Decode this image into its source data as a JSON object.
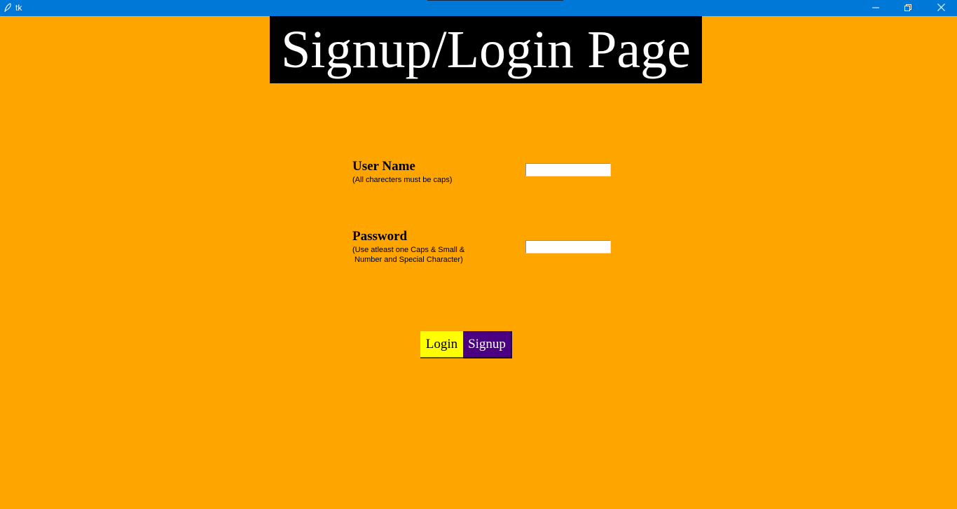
{
  "window": {
    "title": "tk",
    "background_color": "#ffa500",
    "titlebar_color": "#0078d7",
    "icons": [
      "feather-icon",
      "minimize-icon",
      "restore-icon",
      "close-icon"
    ]
  },
  "header": {
    "title": "Signup/Login Page"
  },
  "form": {
    "username": {
      "label": "User Name",
      "hint": "(All charecters must be caps)",
      "value": "",
      "placeholder": ""
    },
    "password": {
      "label": "Password",
      "hint_line1": "(Use atleast one Caps & Small &",
      "hint_line2": " Number and Special Character)",
      "value": "",
      "placeholder": ""
    }
  },
  "buttons": {
    "login": {
      "label": "Login",
      "color": "#ffff00"
    },
    "signup": {
      "label": "Signup",
      "color": "#4b0082"
    }
  }
}
